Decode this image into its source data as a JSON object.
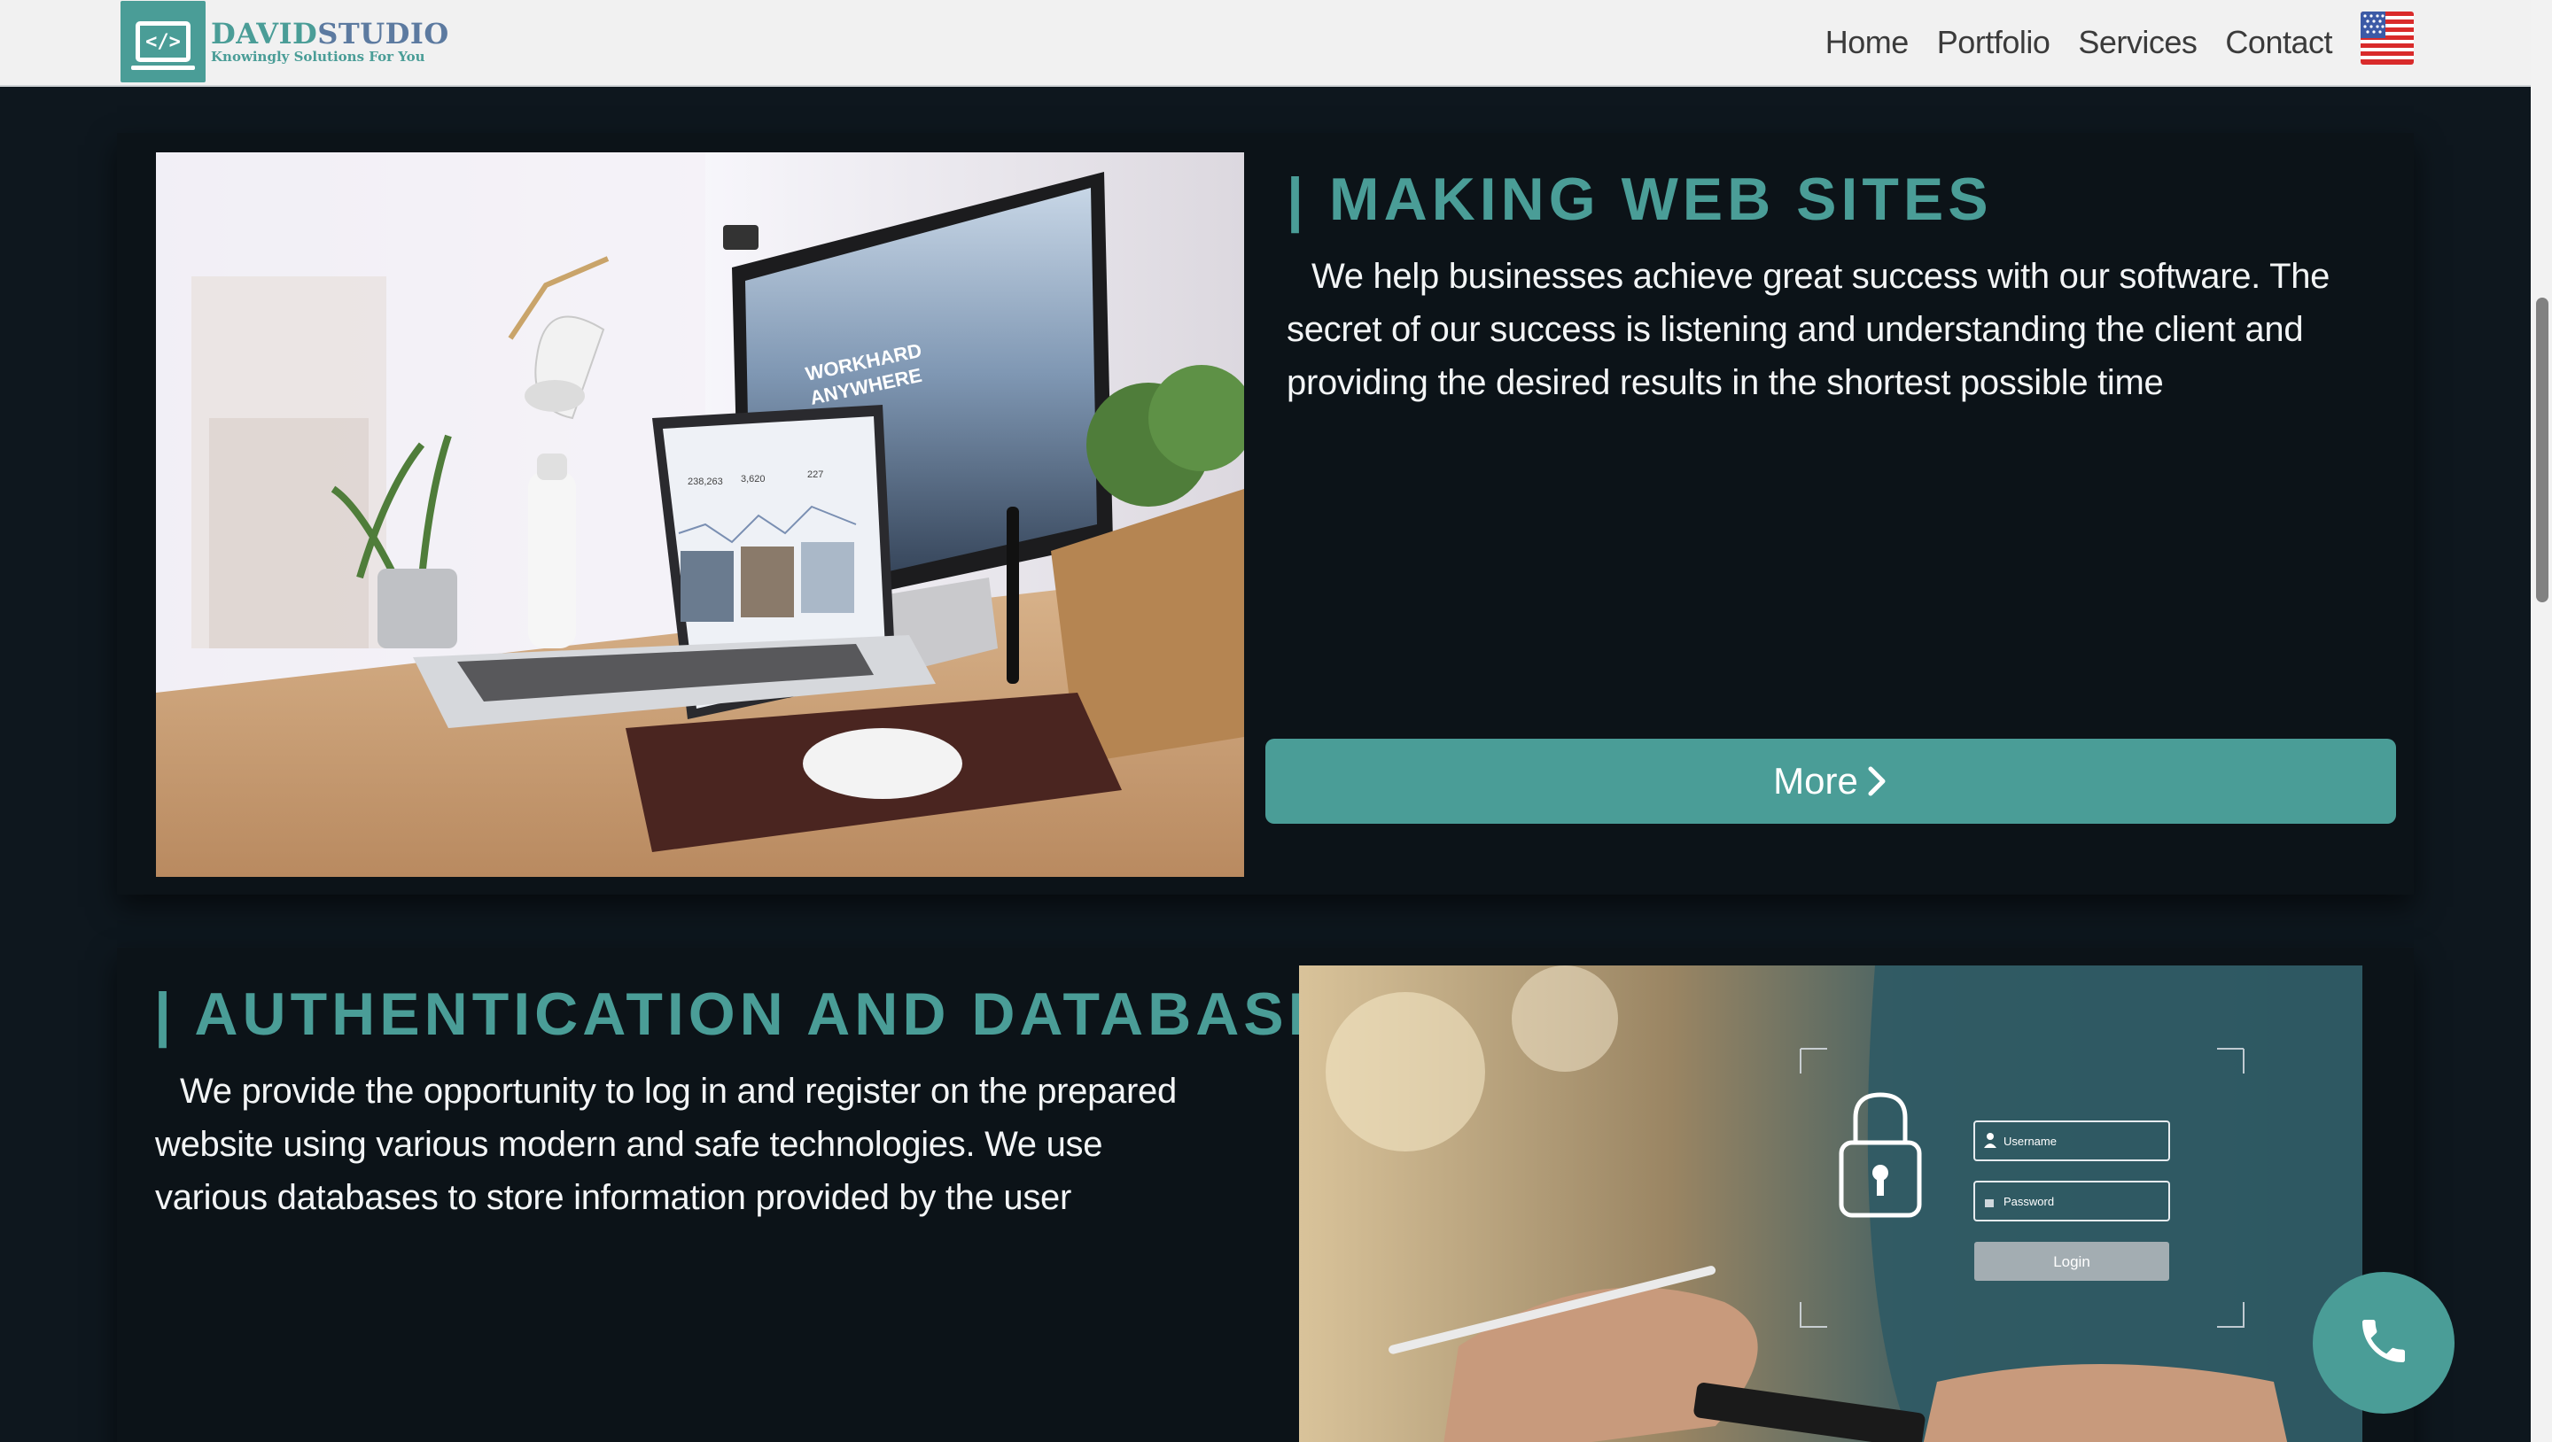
{
  "header": {
    "logo_title_part1": "DAVID",
    "logo_title_part2": "STUDIO",
    "logo_subtitle": "Knowingly Solutions For You",
    "logo_icon": "code-screen-icon",
    "nav": [
      {
        "label": "Home"
      },
      {
        "label": "Portfolio"
      },
      {
        "label": "Services"
      },
      {
        "label": "Contact"
      }
    ],
    "language_flag": "us-flag-icon"
  },
  "services": [
    {
      "title": "| MAKING WEB SITES",
      "description": "We help businesses achieve great success with our software. The secret of our success is listening and understanding the client and providing the desired results in the shortest possible time",
      "button_label": "More",
      "button_icon": "chevron-right-icon"
    },
    {
      "title": "| AUTHENTICATION AND DATABASE",
      "description": "We provide the opportunity to log in and register on the prepared website using various modern and safe technologies. We use various databases to store information provided by the user",
      "login_ui": {
        "username_placeholder": "Username",
        "password_placeholder": "Password",
        "login_label": "Login"
      }
    }
  ],
  "photo_screen_text": {
    "line1": "WORKHARD",
    "line2": "ANYWHERE",
    "stat1": "238,263",
    "stat2": "3,620",
    "stat3": "227"
  },
  "floating": {
    "call_icon": "phone-icon"
  },
  "colors": {
    "accent": "#4a9d97",
    "background": "#0e171e",
    "card": "#0c1318",
    "header": "#f1f1f1"
  }
}
